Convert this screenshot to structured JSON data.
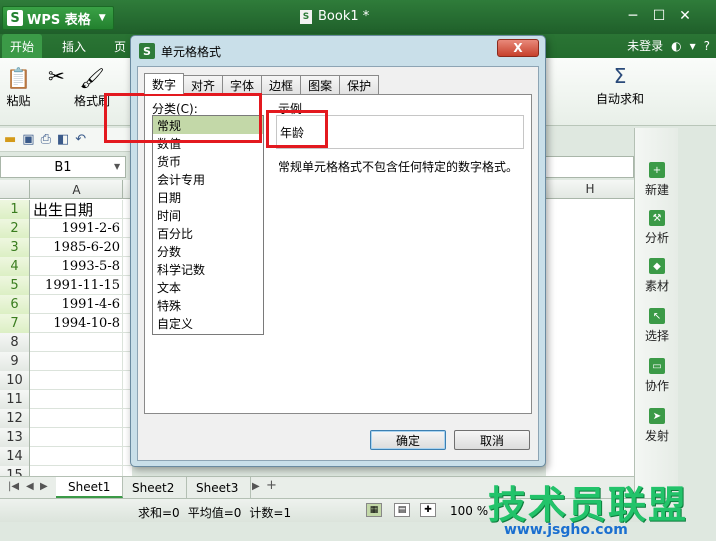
{
  "titlebar": {
    "app_name": "WPS 表格",
    "app_logo": "S",
    "doc_title": "Book1 *",
    "doc_icon": "S"
  },
  "menu": {
    "start": "开始",
    "insert": "插入",
    "page": "页",
    "login": "未登录",
    "help": "?"
  },
  "ribbon": {
    "paste": "粘贴",
    "format_painter": "格式刷",
    "autosum": "自动求和",
    "sigma": "Σ"
  },
  "namebox": {
    "value": "B1"
  },
  "grid": {
    "col_a": "A",
    "col_h": "H",
    "rows": [
      {
        "n": "1",
        "v": "出生日期",
        "header": true
      },
      {
        "n": "2",
        "v": "1991-2-6"
      },
      {
        "n": "3",
        "v": "1985-6-20"
      },
      {
        "n": "4",
        "v": "1993-5-8"
      },
      {
        "n": "5",
        "v": "1991-11-15"
      },
      {
        "n": "6",
        "v": "1991-4-6"
      },
      {
        "n": "7",
        "v": "1994-10-8"
      },
      {
        "n": "8",
        "v": ""
      },
      {
        "n": "9",
        "v": ""
      },
      {
        "n": "10",
        "v": ""
      },
      {
        "n": "11",
        "v": ""
      },
      {
        "n": "12",
        "v": ""
      },
      {
        "n": "13",
        "v": ""
      },
      {
        "n": "14",
        "v": ""
      },
      {
        "n": "15",
        "v": ""
      }
    ]
  },
  "sheets": {
    "tabs": [
      "Sheet1",
      "Sheet2",
      "Sheet3"
    ],
    "add": "+"
  },
  "status": {
    "sum": "求和=0",
    "avg": "平均值=0",
    "count": "计数=1",
    "zoom": "100 %"
  },
  "taskpane": {
    "items": [
      "新建",
      "分析",
      "素材",
      "选择",
      "协作",
      "发射"
    ]
  },
  "dialog": {
    "title": "单元格格式",
    "close": "X",
    "tabs": [
      "数字",
      "对齐",
      "字体",
      "边框",
      "图案",
      "保护"
    ],
    "category_label": "分类(C):",
    "categories": [
      "常规",
      "数值",
      "货币",
      "会计专用",
      "日期",
      "时间",
      "百分比",
      "分数",
      "科学记数",
      "文本",
      "特殊",
      "自定义"
    ],
    "selected_category": "常规",
    "sample_label": "示例",
    "sample_value": "年龄",
    "description": "常规单元格格式不包含任何特定的数字格式。",
    "ok": "确定",
    "cancel": "取消"
  },
  "watermark": {
    "text": "技术员联盟",
    "url": "www.jsgho.com"
  }
}
